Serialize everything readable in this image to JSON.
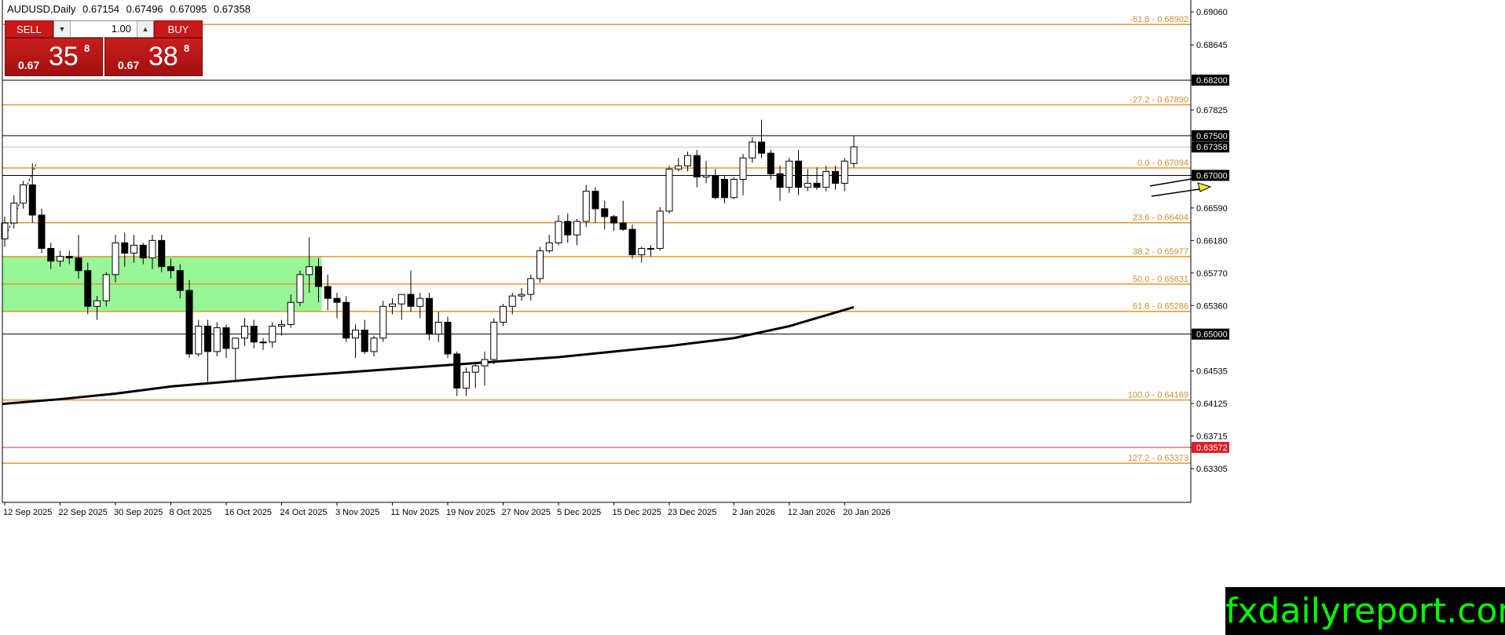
{
  "header": {
    "symbol": "AUDUSD,Daily",
    "open": "0.67154",
    "high": "0.67496",
    "low": "0.67095",
    "close": "0.67358"
  },
  "trade_panel": {
    "sell_label": "SELL",
    "buy_label": "BUY",
    "lot": "1.00",
    "sell_prefix": "0.67",
    "sell_big": "35",
    "sell_sup": "8",
    "buy_prefix": "0.67",
    "buy_big": "38",
    "buy_sup": "8"
  },
  "watermark": "fxdailyreport.com",
  "colors": {
    "fib": "#e8962e",
    "fib_label": "#d08a2e",
    "bid_line": "#c4343a",
    "zone": "#98f598",
    "ma": "#000000",
    "arrow_fill": "#f2f22a"
  },
  "chart_data": {
    "type": "candlestick",
    "symbol": "AUDUSD",
    "timeframe": "Daily",
    "ylim": [
      0.6288,
      0.6921
    ],
    "y_ticks": [
      "0.69060",
      "0.68645",
      "0.68200",
      "0.67825",
      "0.67500",
      "0.67358",
      "0.67000",
      "0.66590",
      "0.66180",
      "0.65770",
      "0.65360",
      "0.65000",
      "0.64535",
      "0.64125",
      "0.63715",
      "0.63572",
      "0.63305"
    ],
    "x_ticks": [
      "12 Sep 2025",
      "22 Sep 2025",
      "30 Sep 2025",
      "8 Oct 2025",
      "16 Oct 2025",
      "24 Oct 2025",
      "3 Nov 2025",
      "11 Nov 2025",
      "19 Nov 2025",
      "27 Nov 2025",
      "5 Dec 2025",
      "15 Dec 2025",
      "23 Dec 2025",
      "2 Jan 2026",
      "12 Jan 2026",
      "20 Jan 2026"
    ],
    "fib_levels": [
      {
        "label": "-61.8 - 0.68902",
        "price": 0.68902
      },
      {
        "label": "-27.2 - 0.67890",
        "price": 0.6789
      },
      {
        "label": "0.0 - 0.67094",
        "price": 0.67094
      },
      {
        "label": "23.6 - 0.66404",
        "price": 0.66404
      },
      {
        "label": "38.2 - 0.65977",
        "price": 0.65977
      },
      {
        "label": "50.0 - 0.65631",
        "price": 0.65631
      },
      {
        "label": "61.8 - 0.65286",
        "price": 0.65286
      },
      {
        "label": "100.0 - 0.64169",
        "price": 0.64169
      },
      {
        "label": "127.2 - 0.63373",
        "price": 0.63373
      }
    ],
    "hlines": [
      {
        "label": "0.68200",
        "price": 0.682
      },
      {
        "label": "0.67500",
        "price": 0.675
      },
      {
        "label": "0.67000",
        "price": 0.67
      },
      {
        "label": "0.65000",
        "price": 0.65
      }
    ],
    "current_price": {
      "label": "0.67358",
      "price": 0.67358
    },
    "bid_line": {
      "label": "0.63572",
      "price": 0.63572
    },
    "zone": {
      "price_top": 0.65977,
      "price_bottom": 0.65286
    },
    "candles": [
      [
        "12 Sep 2025",
        0.662,
        0.6648,
        0.661,
        0.664
      ],
      [
        "15 Sep 2025",
        0.664,
        0.6675,
        0.6633,
        0.6665
      ],
      [
        "16 Sep 2025",
        0.6665,
        0.6693,
        0.6658,
        0.6688
      ],
      [
        "17 Sep 2025",
        0.6688,
        0.6715,
        0.664,
        0.665
      ],
      [
        "18 Sep 2025",
        0.665,
        0.6658,
        0.6602,
        0.6608
      ],
      [
        "19 Sep 2025",
        0.6608,
        0.6615,
        0.6582,
        0.6592
      ],
      [
        "22 Sep 2025",
        0.6592,
        0.6605,
        0.6585,
        0.6598
      ],
      [
        "23 Sep 2025",
        0.6598,
        0.6605,
        0.6588,
        0.6596
      ],
      [
        "24 Sep 2025",
        0.6596,
        0.6625,
        0.657,
        0.658
      ],
      [
        "25 Sep 2025",
        0.658,
        0.659,
        0.6525,
        0.6535
      ],
      [
        "26 Sep 2025",
        0.6535,
        0.6548,
        0.6518,
        0.6542
      ],
      [
        "29 Sep 2025",
        0.6542,
        0.6578,
        0.6535,
        0.6575
      ],
      [
        "30 Sep 2025",
        0.6575,
        0.6625,
        0.6565,
        0.6615
      ],
      [
        "1 Oct 2025",
        0.6615,
        0.6628,
        0.6585,
        0.6602
      ],
      [
        "2 Oct 2025",
        0.6602,
        0.6625,
        0.659,
        0.6612
      ],
      [
        "3 Oct 2025",
        0.6612,
        0.6615,
        0.6588,
        0.6596
      ],
      [
        "6 Oct 2025",
        0.6596,
        0.6625,
        0.6582,
        0.6618
      ],
      [
        "7 Oct 2025",
        0.6618,
        0.6625,
        0.6578,
        0.6585
      ],
      [
        "8 Oct 2025",
        0.6585,
        0.6595,
        0.657,
        0.658
      ],
      [
        "9 Oct 2025",
        0.658,
        0.6588,
        0.6545,
        0.6555
      ],
      [
        "10 Oct 2025",
        0.6555,
        0.6568,
        0.647,
        0.6475
      ],
      [
        "13 Oct 2025",
        0.6475,
        0.6518,
        0.6472,
        0.651
      ],
      [
        "14 Oct 2025",
        0.651,
        0.6518,
        0.644,
        0.6478
      ],
      [
        "15 Oct 2025",
        0.6478,
        0.6515,
        0.6472,
        0.6508
      ],
      [
        "16 Oct 2025",
        0.6508,
        0.6512,
        0.647,
        0.6482
      ],
      [
        "17 Oct 2025",
        0.6482,
        0.6495,
        0.6442,
        0.6495
      ],
      [
        "20 Oct 2025",
        0.6495,
        0.652,
        0.6485,
        0.651
      ],
      [
        "21 Oct 2025",
        0.651,
        0.6518,
        0.6482,
        0.649
      ],
      [
        "22 Oct 2025",
        0.649,
        0.6495,
        0.648,
        0.649
      ],
      [
        "23 Oct 2025",
        0.649,
        0.6515,
        0.6483,
        0.651
      ],
      [
        "24 Oct 2025",
        0.651,
        0.6518,
        0.6498,
        0.6512
      ],
      [
        "27 Oct 2025",
        0.6512,
        0.655,
        0.6508,
        0.654
      ],
      [
        "28 Oct 2025",
        0.654,
        0.658,
        0.6535,
        0.6575
      ],
      [
        "29 Oct 2025",
        0.6575,
        0.6622,
        0.6552,
        0.6585
      ],
      [
        "30 Oct 2025",
        0.6585,
        0.6596,
        0.654,
        0.656
      ],
      [
        "31 Oct 2025",
        0.656,
        0.6575,
        0.653,
        0.6545
      ],
      [
        "3 Nov 2025",
        0.6545,
        0.6552,
        0.652,
        0.654
      ],
      [
        "4 Nov 2025",
        0.654,
        0.6548,
        0.649,
        0.6495
      ],
      [
        "5 Nov 2025",
        0.6495,
        0.6512,
        0.647,
        0.6505
      ],
      [
        "6 Nov 2025",
        0.6505,
        0.6518,
        0.6475,
        0.6478
      ],
      [
        "7 Nov 2025",
        0.6478,
        0.6498,
        0.6472,
        0.6495
      ],
      [
        "10 Nov 2025",
        0.6495,
        0.6542,
        0.649,
        0.6535
      ],
      [
        "11 Nov 2025",
        0.6535,
        0.6545,
        0.6525,
        0.6538
      ],
      [
        "12 Nov 2025",
        0.6538,
        0.655,
        0.6518,
        0.655
      ],
      [
        "13 Nov 2025",
        0.655,
        0.658,
        0.6528,
        0.6535
      ],
      [
        "14 Nov 2025",
        0.6535,
        0.6552,
        0.652,
        0.6545
      ],
      [
        "17 Nov 2025",
        0.6545,
        0.6552,
        0.6492,
        0.65
      ],
      [
        "18 Nov 2025",
        0.65,
        0.6528,
        0.649,
        0.6515
      ],
      [
        "19 Nov 2025",
        0.6515,
        0.6522,
        0.647,
        0.6475
      ],
      [
        "20 Nov 2025",
        0.6475,
        0.6478,
        0.6422,
        0.6432
      ],
      [
        "21 Nov 2025",
        0.6432,
        0.6458,
        0.6422,
        0.6452
      ],
      [
        "24 Nov 2025",
        0.6452,
        0.6463,
        0.6432,
        0.646
      ],
      [
        "25 Nov 2025",
        0.646,
        0.6478,
        0.6435,
        0.6468
      ],
      [
        "26 Nov 2025",
        0.6468,
        0.652,
        0.6462,
        0.6515
      ],
      [
        "27 Nov 2025",
        0.6515,
        0.6538,
        0.651,
        0.6535
      ],
      [
        "28 Nov 2025",
        0.6535,
        0.6552,
        0.6525,
        0.6548
      ],
      [
        "1 Dec 2025",
        0.6548,
        0.6558,
        0.6542,
        0.655
      ],
      [
        "2 Dec 2025",
        0.655,
        0.6575,
        0.6542,
        0.657
      ],
      [
        "3 Dec 2025",
        0.657,
        0.661,
        0.6565,
        0.6605
      ],
      [
        "4 Dec 2025",
        0.6605,
        0.6625,
        0.6602,
        0.6615
      ],
      [
        "5 Dec 2025",
        0.6615,
        0.665,
        0.6612,
        0.6642
      ],
      [
        "8 Dec 2025",
        0.6642,
        0.6652,
        0.6615,
        0.6625
      ],
      [
        "9 Dec 2025",
        0.6625,
        0.6645,
        0.6612,
        0.6642
      ],
      [
        "10 Dec 2025",
        0.6642,
        0.6688,
        0.6635,
        0.668
      ],
      [
        "11 Dec 2025",
        0.668,
        0.6685,
        0.664,
        0.6658
      ],
      [
        "12 Dec 2025",
        0.6658,
        0.6668,
        0.6632,
        0.6648
      ],
      [
        "15 Dec 2025",
        0.6648,
        0.665,
        0.663,
        0.664
      ],
      [
        "16 Dec 2025",
        0.664,
        0.6668,
        0.663,
        0.6632
      ],
      [
        "17 Dec 2025",
        0.6632,
        0.6638,
        0.6595,
        0.66
      ],
      [
        "18 Dec 2025",
        0.66,
        0.661,
        0.659,
        0.6608
      ],
      [
        "19 Dec 2025",
        0.6608,
        0.6612,
        0.6598,
        0.6608
      ],
      [
        "22 Dec 2025",
        0.6608,
        0.666,
        0.6605,
        0.6655
      ],
      [
        "23 Dec 2025",
        0.6655,
        0.6712,
        0.6652,
        0.6708
      ],
      [
        "24 Dec 2025",
        0.6708,
        0.6722,
        0.6705,
        0.6712
      ],
      [
        "26 Dec 2025",
        0.6712,
        0.673,
        0.6705,
        0.6725
      ],
      [
        "29 Dec 2025",
        0.6725,
        0.6732,
        0.6685,
        0.6698
      ],
      [
        "30 Dec 2025",
        0.6698,
        0.6718,
        0.669,
        0.67
      ],
      [
        "31 Dec 2025",
        0.67,
        0.6708,
        0.667,
        0.6672
      ],
      [
        "1 Jan 2026",
        0.6695,
        0.67,
        0.6665,
        0.6672
      ],
      [
        "2 Jan 2026",
        0.6672,
        0.6698,
        0.667,
        0.6695
      ],
      [
        "5 Jan 2026",
        0.6695,
        0.6727,
        0.6675,
        0.6722
      ],
      [
        "6 Jan 2026",
        0.6722,
        0.6748,
        0.6716,
        0.6742
      ],
      [
        "7 Jan 2026",
        0.6742,
        0.677,
        0.6722,
        0.6728
      ],
      [
        "8 Jan 2026",
        0.6728,
        0.6732,
        0.6695,
        0.6702
      ],
      [
        "9 Jan 2026",
        0.6702,
        0.6712,
        0.6668,
        0.6685
      ],
      [
        "12 Jan 2026",
        0.6685,
        0.6722,
        0.6678,
        0.6718
      ],
      [
        "13 Jan 2026",
        0.6718,
        0.6732,
        0.6675,
        0.6685
      ],
      [
        "14 Jan 2026",
        0.6685,
        0.6708,
        0.668,
        0.669
      ],
      [
        "15 Jan 2026",
        0.669,
        0.671,
        0.6682,
        0.6685
      ],
      [
        "16 Jan 2026",
        0.6685,
        0.6712,
        0.668,
        0.6705
      ],
      [
        "19 Jan 2026",
        0.6705,
        0.6712,
        0.6682,
        0.669
      ],
      [
        "20 Jan 2026",
        0.669,
        0.6722,
        0.668,
        0.6718
      ],
      [
        "21 Jan 2026",
        0.6715,
        0.675,
        0.671,
        0.6736
      ]
    ],
    "moving_average": [
      [
        "12 Sep 2025",
        0.6412
      ],
      [
        "22 Sep 2025",
        0.6418
      ],
      [
        "30 Sep 2025",
        0.6425
      ],
      [
        "8 Oct 2025",
        0.6434
      ],
      [
        "16 Oct 2025",
        0.644
      ],
      [
        "24 Oct 2025",
        0.6446
      ],
      [
        "3 Nov 2025",
        0.6451
      ],
      [
        "11 Nov 2025",
        0.6456
      ],
      [
        "19 Nov 2025",
        0.6461
      ],
      [
        "27 Nov 2025",
        0.6466
      ],
      [
        "5 Dec 2025",
        0.6471
      ],
      [
        "15 Dec 2025",
        0.6478
      ],
      [
        "23 Dec 2025",
        0.6485
      ],
      [
        "2 Jan 2026",
        0.6495
      ],
      [
        "12 Jan 2026",
        0.651
      ],
      [
        "21 Jan 2026",
        0.6534
      ]
    ]
  }
}
